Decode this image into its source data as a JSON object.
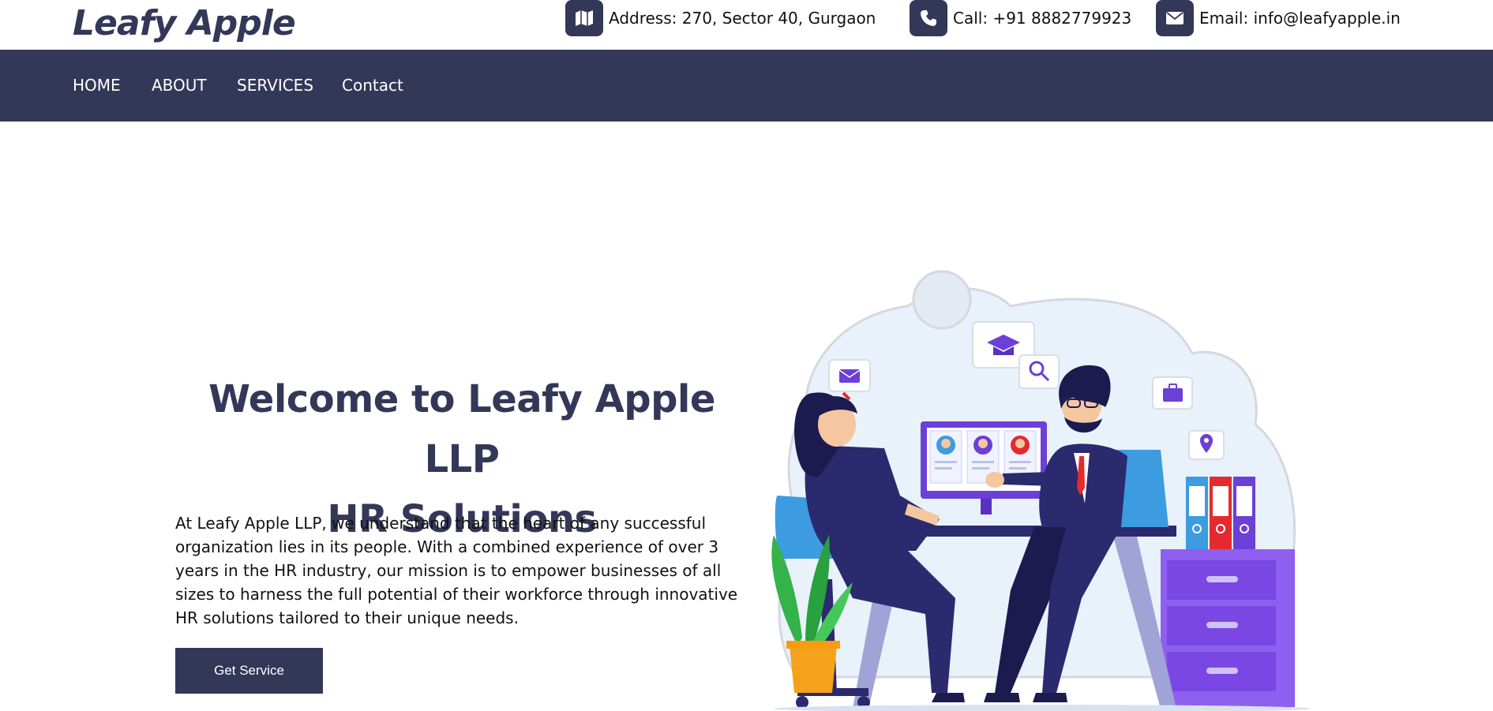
{
  "brand": {
    "name": "Leafy Apple"
  },
  "topbar": {
    "address": {
      "icon": "map-icon",
      "text": "Address: 270, Sector 40, Gurgaon"
    },
    "phone": {
      "icon": "phone-icon",
      "text": "Call: +91 8882779923"
    },
    "email": {
      "icon": "envelope-icon",
      "text": "Email: info@leafyapple.in"
    }
  },
  "nav": {
    "items": [
      {
        "label": "HOME"
      },
      {
        "label": "ABOUT"
      },
      {
        "label": "SERVICES"
      },
      {
        "label": "Contact"
      }
    ]
  },
  "hero": {
    "title_line1": "Welcome to Leafy Apple LLP",
    "title_line2": "HR Solutions",
    "paragraph_line1": "At Leafy Apple LLP, we understand that the heart of any successful",
    "paragraph_line2": "organization lies in its people. With a combined experience of over 3",
    "paragraph_line3": "years in the HR industry, our mission is to empower businesses of all",
    "paragraph_line4": "sizes to harness the full potential of their workforce through innovative",
    "paragraph_line5": "HR solutions tailored to their unique needs.",
    "cta_label": "Get Service"
  },
  "colors": {
    "primary": "#333859",
    "accent_purple": "#6c3fd6",
    "accent_blue": "#3d9be0",
    "accent_red": "#e52a2f"
  }
}
